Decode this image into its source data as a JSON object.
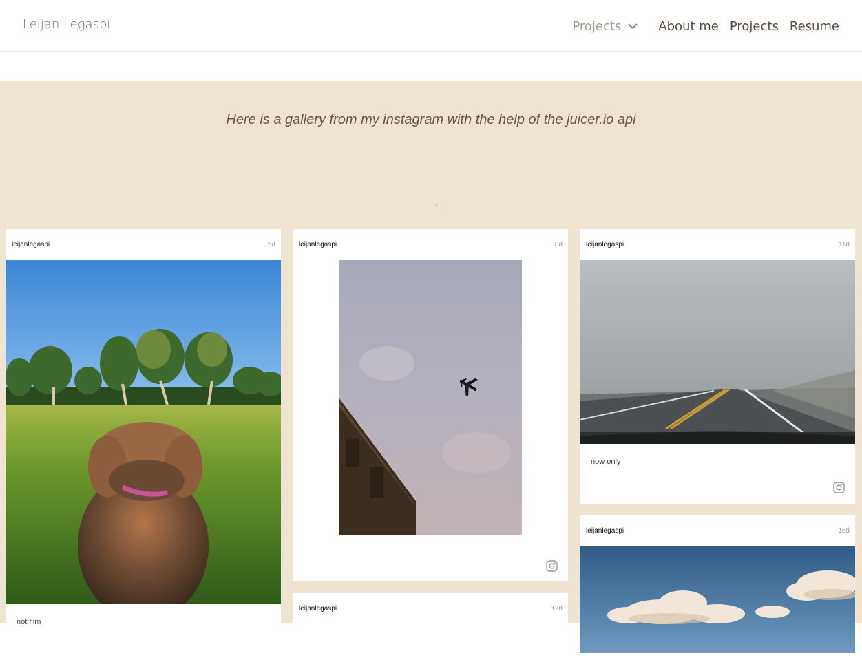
{
  "header": {
    "brand": "Leijan Legaspi",
    "dropdown_label": "Projects",
    "links": [
      "About me",
      "Projects",
      "Resume"
    ]
  },
  "gallery": {
    "intro": "Here is a gallery from my instagram with the help of the juicer.io api",
    "posts": [
      {
        "user": "leijanlegaspi",
        "time": "5d",
        "caption": "not film"
      },
      {
        "user": "leijanlegaspi",
        "time": "8d",
        "caption": ""
      },
      {
        "user": "leijanlegaspi",
        "time": "11d",
        "caption": "now only"
      },
      {
        "user": "leijanlegaspi",
        "time": "16d",
        "caption": ""
      },
      {
        "user": "leijanlegaspi",
        "time": "12d",
        "caption": ""
      }
    ]
  },
  "colors": {
    "band_background": "#efe3d1",
    "nav_text": "#5c4b3e",
    "dropdown_text": "#a59b8e"
  },
  "icons": {
    "dropdown": "chevron-down-icon",
    "source": "instagram-icon"
  }
}
